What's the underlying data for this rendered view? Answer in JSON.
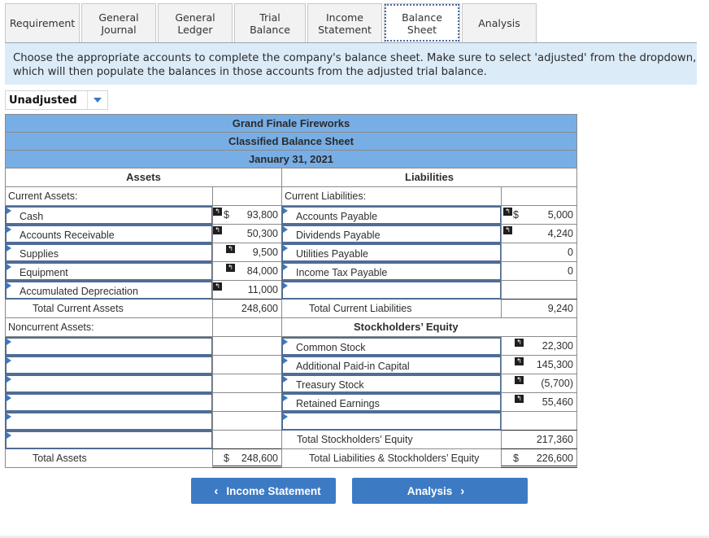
{
  "tabs": [
    {
      "label": "Requirement",
      "active": false
    },
    {
      "label": "General\nJournal",
      "active": false
    },
    {
      "label": "General\nLedger",
      "active": false
    },
    {
      "label": "Trial Balance",
      "active": false
    },
    {
      "label": "Income\nStatement",
      "active": false
    },
    {
      "label": "Balance Sheet",
      "active": true
    },
    {
      "label": "Analysis",
      "active": false
    }
  ],
  "instructions": "Choose the appropriate accounts to complete the company's balance sheet. Make sure to select 'adjusted' from the dropdown, which will then populate the balances in those accounts from the adjusted trial balance.",
  "dropdown": {
    "selected": "Unadjusted"
  },
  "sheet": {
    "company": "Grand Finale Fireworks",
    "title": "Classified Balance Sheet",
    "date": "January 31, 2021",
    "assets_header": "Assets",
    "liabilities_header": "Liabilities",
    "current_assets_label": "Current Assets:",
    "current_liabilities_label": "Current Liabilities:",
    "current_assets": [
      {
        "account": "Cash",
        "dollar": "$",
        "amount": "93,800"
      },
      {
        "account": "Accounts Receivable",
        "dollar": "",
        "amount": "50,300"
      },
      {
        "account": "Supplies",
        "dollar": "",
        "amount": "9,500"
      },
      {
        "account": "Equipment",
        "dollar": "",
        "amount": "84,000"
      },
      {
        "account": "Accumulated Depreciation",
        "dollar": "",
        "amount": "11,000"
      }
    ],
    "total_current_assets_label": "Total Current Assets",
    "total_current_assets": "248,600",
    "current_liabilities": [
      {
        "account": "Accounts Payable",
        "dollar": "$",
        "amount": "5,000"
      },
      {
        "account": "Dividends Payable",
        "dollar": "",
        "amount": "4,240"
      },
      {
        "account": "Utilities Payable",
        "dollar": "",
        "amount": "0"
      },
      {
        "account": "Income Tax Payable",
        "dollar": "",
        "amount": "0"
      },
      {
        "account": "",
        "dollar": "",
        "amount": ""
      }
    ],
    "total_current_liabilities_label": "Total Current Liabilities",
    "total_current_liabilities": "9,240",
    "noncurrent_assets_label": "Noncurrent Assets:",
    "stockholders_equity_header": "Stockholders’ Equity",
    "equity": [
      {
        "account": "Common Stock",
        "amount": "22,300"
      },
      {
        "account": "Additional Paid-in Capital",
        "amount": "145,300"
      },
      {
        "account": "Treasury Stock",
        "amount": "(5,700)"
      },
      {
        "account": "Retained Earnings",
        "amount": "55,460"
      },
      {
        "account": "",
        "amount": ""
      }
    ],
    "total_equity_label": "Total Stockholders’ Equity",
    "total_equity": "217,360",
    "total_assets_label": "Total Assets",
    "total_assets_dollar": "$",
    "total_assets": "248,600",
    "total_liab_equity_label": "Total Liabilities & Stockholders’ Equity",
    "total_liab_equity_dollar": "$",
    "total_liab_equity": "226,600"
  },
  "nav": {
    "prev_label": "Income Statement",
    "next_label": "Analysis",
    "prev_icon": "‹",
    "next_icon": "›"
  },
  "icons": {
    "flag": "↰"
  }
}
